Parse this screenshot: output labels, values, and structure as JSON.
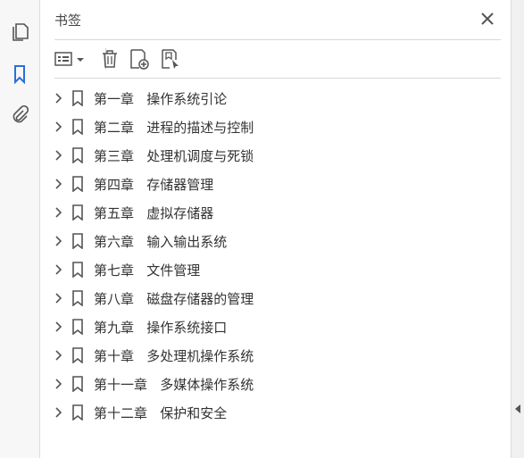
{
  "panel": {
    "title": "书签"
  },
  "bookmarks": [
    {
      "label": "第一章   操作系统引论"
    },
    {
      "label": "第二章   进程的描述与控制"
    },
    {
      "label": "第三章   处理机调度与死锁"
    },
    {
      "label": "第四章   存储器管理"
    },
    {
      "label": "第五章   虚拟存储器"
    },
    {
      "label": "第六章   输入输出系统"
    },
    {
      "label": "第七章   文件管理"
    },
    {
      "label": "第八章   磁盘存储器的管理"
    },
    {
      "label": "第九章   操作系统接口"
    },
    {
      "label": "第十章   多处理机操作系统"
    },
    {
      "label": "第十一章   多媒体操作系统"
    },
    {
      "label": "第十二章   保护和安全"
    }
  ],
  "icons": {
    "rail": [
      "pages-icon",
      "bookmark-icon",
      "attachment-icon"
    ],
    "toolbar": [
      "options-icon",
      "delete-icon",
      "new-bookmark-icon",
      "bookmark-from-selection-icon"
    ],
    "close": "close-icon"
  },
  "colors": {
    "accent": "#2b6fd6",
    "icon": "#555555",
    "text": "#333333"
  }
}
